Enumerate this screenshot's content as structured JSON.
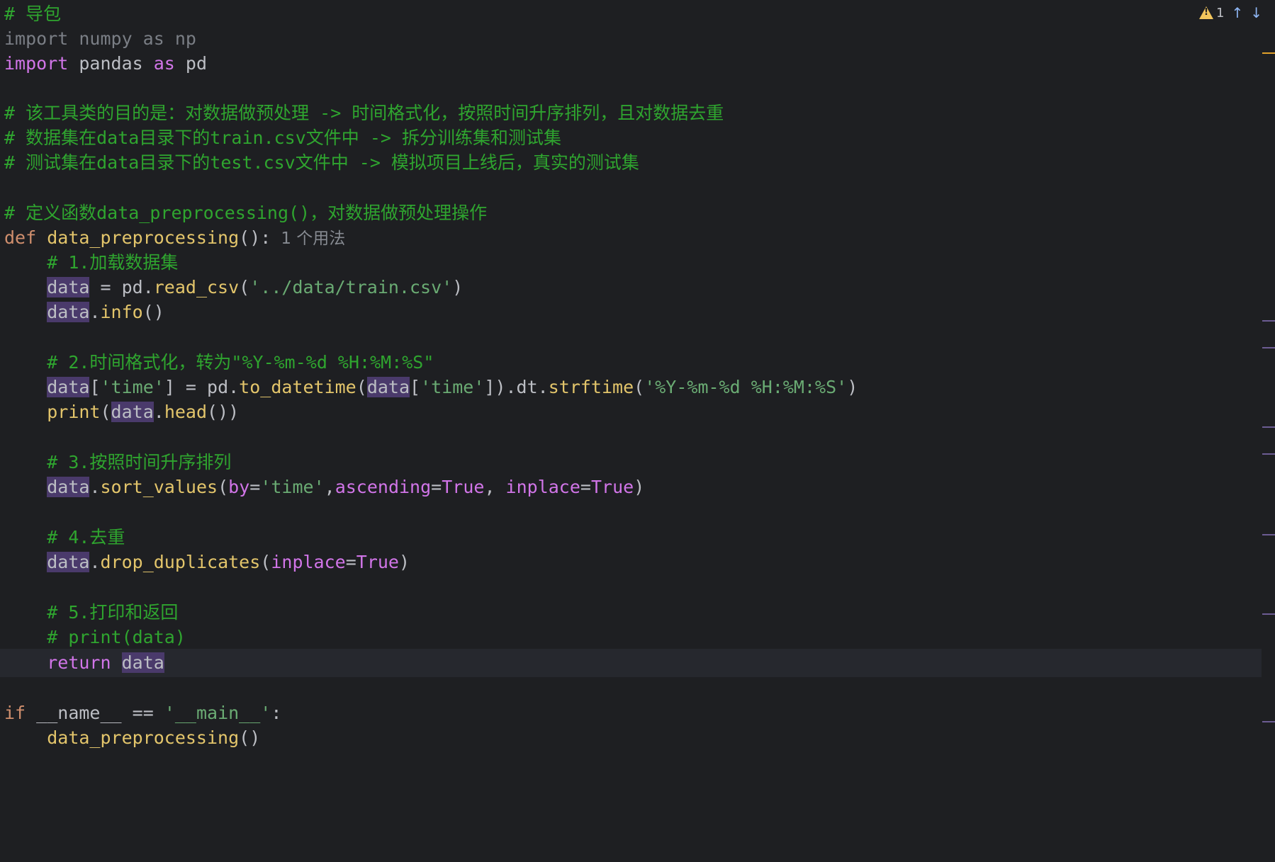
{
  "toolbar": {
    "warning_count": "1",
    "warning_icon": "warning-triangle-icon",
    "prev_icon": "arrow-up-icon",
    "next_icon": "arrow-down-icon",
    "prev_glyph": "↑",
    "next_glyph": "↓"
  },
  "hint": {
    "usages": "1 个用法"
  },
  "code": {
    "l1": "# 导包",
    "l2": "import numpy as np",
    "l3_kw": "import",
    "l3_rest": " pandas ",
    "l3_as": "as",
    "l3_end": " pd",
    "l5": "# 该工具类的目的是：对数据做预处理 -> 时间格式化，按照时间升序排列，且对数据去重",
    "l6": "# 数据集在data目录下的train.csv文件中 -> 拆分训练集和测试集",
    "l7": "# 测试集在data目录下的test.csv文件中 -> 模拟项目上线后，真实的测试集",
    "l9": "# 定义函数data_preprocessing()，对数据做预处理操作",
    "l10_def": "def",
    "l10_name": "data_preprocessing",
    "l10_end": "():",
    "l11": "# 1.加载数据集",
    "data": "data",
    "l12_mid": " = pd.",
    "l12_fn": "read_csv",
    "l12_o": "(",
    "l12_str": "'../data/train.csv'",
    "l12_c": ")",
    "l13_dot": ".",
    "l13_fn": "info",
    "l13_end": "()",
    "l15": "# 2.时间格式化，转为\"%Y-%m-%d %H:%M:%S\"",
    "l16_a": "[",
    "l16_s1": "'time'",
    "l16_b": "] = pd.",
    "l16_fn": "to_datetime",
    "l16_c": "(",
    "l16_d": "[",
    "l16_s2": "'time'",
    "l16_e": "]).dt.",
    "l16_fn2": "strftime",
    "l16_f": "(",
    "l16_s3": "'%Y-%m-%d %H:%M:%S'",
    "l16_g": ")",
    "l17_fn": "print",
    "l17_o": "(",
    "l17_dot": ".",
    "l17_fn2": "head",
    "l17_end": "())",
    "l19": "# 3.按照时间升序排列",
    "l20_dot": ".",
    "l20_fn": "sort_values",
    "l20_o": "(",
    "l20_p1": "by",
    "l20_eq1": "=",
    "l20_s": "'time'",
    "l20_comma": ",",
    "l20_p2": "ascending",
    "l20_eq2": "=",
    "l20_t1": "True",
    "l20_comma2": ", ",
    "l20_p3": "inplace",
    "l20_eq3": "=",
    "l20_t2": "True",
    "l20_c": ")",
    "l22": "# 4.去重",
    "l23_dot": ".",
    "l23_fn": "drop_duplicates",
    "l23_o": "(",
    "l23_p": "inplace",
    "l23_eq": "=",
    "l23_t": "True",
    "l23_c": ")",
    "l25": "# 5.打印和返回",
    "l26": "# print(data)",
    "l27_kw": "return",
    "l27_sp": " ",
    "l29_if": "if",
    "l29_sp": " ",
    "l29_name": "__name__",
    "l29_eq": " == ",
    "l29_str": "'__main__'",
    "l29_c": ":",
    "l30_fn": "data_preprocessing",
    "l30_end": "()"
  }
}
